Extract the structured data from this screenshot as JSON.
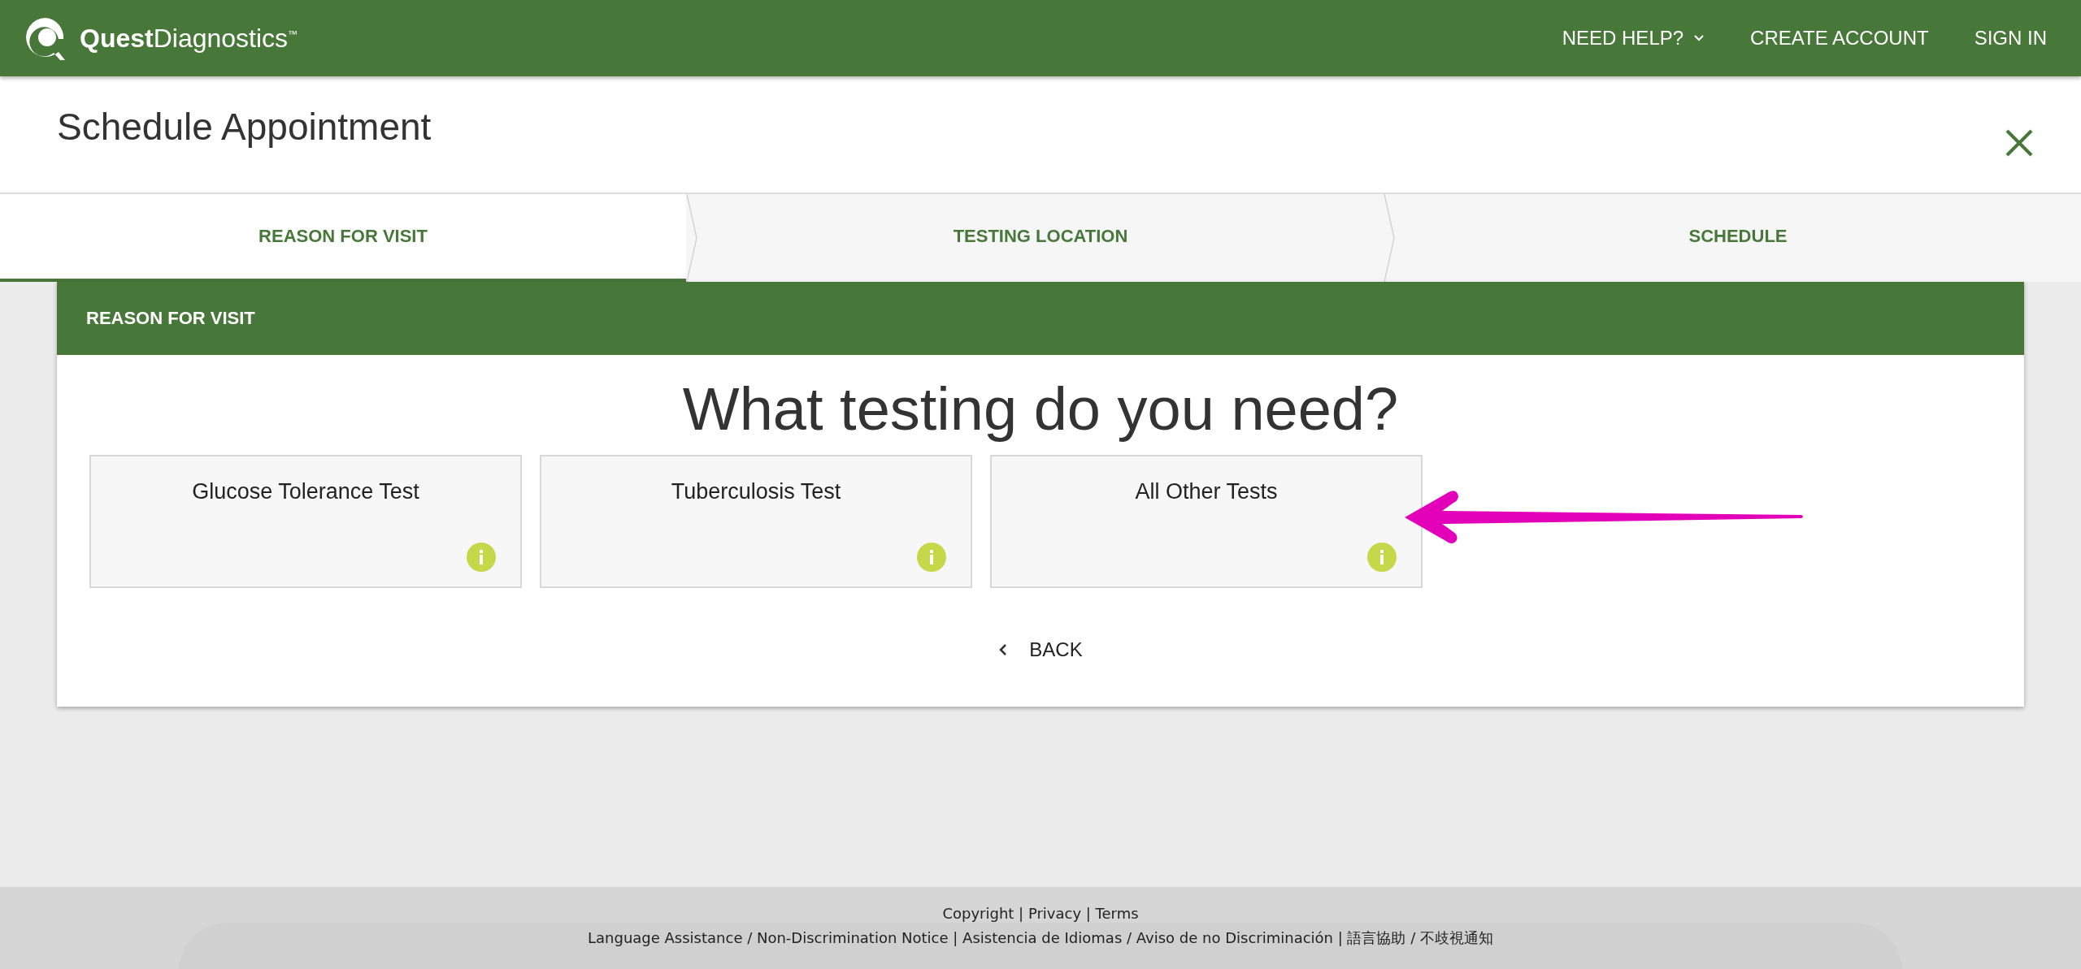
{
  "header": {
    "logo": "**Quest**Diagnostics$^{™}$",
    "nav": [
      {
        "label": "NEED HELP?",
        "kind": "dropdown"
      },
      {
        "label": "CREATE ACCOUNT",
        "kind": "link"
      },
      {
        "label": "SIGN IN",
        "kind": "link"
      }
    ]
  },
  "page_title": "Schedule Appointment",
  "steps": [
    {
      "label": "REASON FOR VISIT",
      "selected": true
    },
    {
      "label": "TESTING LOCATION",
      "selected": false
    },
    {
      "label": "SCHEDULE",
      "selected": false
    }
  ],
  "panel": {
    "title": "REASON FOR VISIT",
    "question": "What testing do you need?",
    "tests": [
      {
        "label": "Glucose Tolerance Test"
      },
      {
        "label": "Tuberculosis Test"
      },
      {
        "label": "All Other Tests"
      }
    ],
    "back": "BACK"
  },
  "footer": {
    "lines": [
      "Copyright | Privacy | Terms",
      "Language Assistance / Non-Discrimination Notice | Asistencia de Idiomas / Aviso de no Discriminación | 語言協助 / 不歧視通知"
    ]
  }
}
